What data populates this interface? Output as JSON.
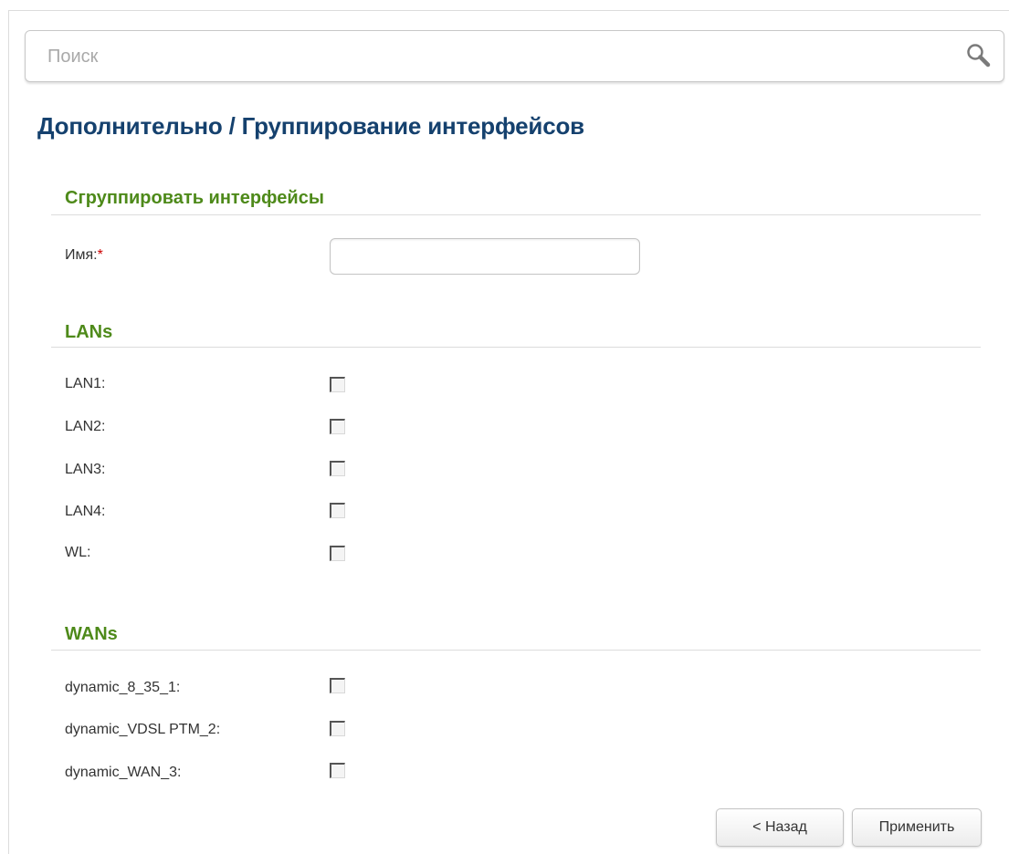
{
  "search": {
    "placeholder": "Поиск",
    "icon": "search-icon"
  },
  "page_title": "Дополнительно /  Группирование интерфейсов",
  "group_section": {
    "title": "Сгруппировать интерфейсы",
    "name_label": "Имя:",
    "name_required_mark": "*",
    "name_value": ""
  },
  "lans": {
    "title": "LANs",
    "items": [
      {
        "label": "LAN1:",
        "checked": false
      },
      {
        "label": "LAN2:",
        "checked": false
      },
      {
        "label": "LAN3:",
        "checked": false
      },
      {
        "label": "LAN4:",
        "checked": false
      },
      {
        "label": "WL:",
        "checked": false
      }
    ]
  },
  "wans": {
    "title": "WANs",
    "items": [
      {
        "label": "dynamic_8_35_1:",
        "checked": false
      },
      {
        "label": "dynamic_VDSL PTM_2:",
        "checked": false
      },
      {
        "label": "dynamic_WAN_3:",
        "checked": false
      }
    ]
  },
  "buttons": {
    "back": "< Назад",
    "apply": "Применить"
  },
  "colors": {
    "title": "#15416e",
    "section_title": "#4e8a1a",
    "required": "#cc0000"
  }
}
